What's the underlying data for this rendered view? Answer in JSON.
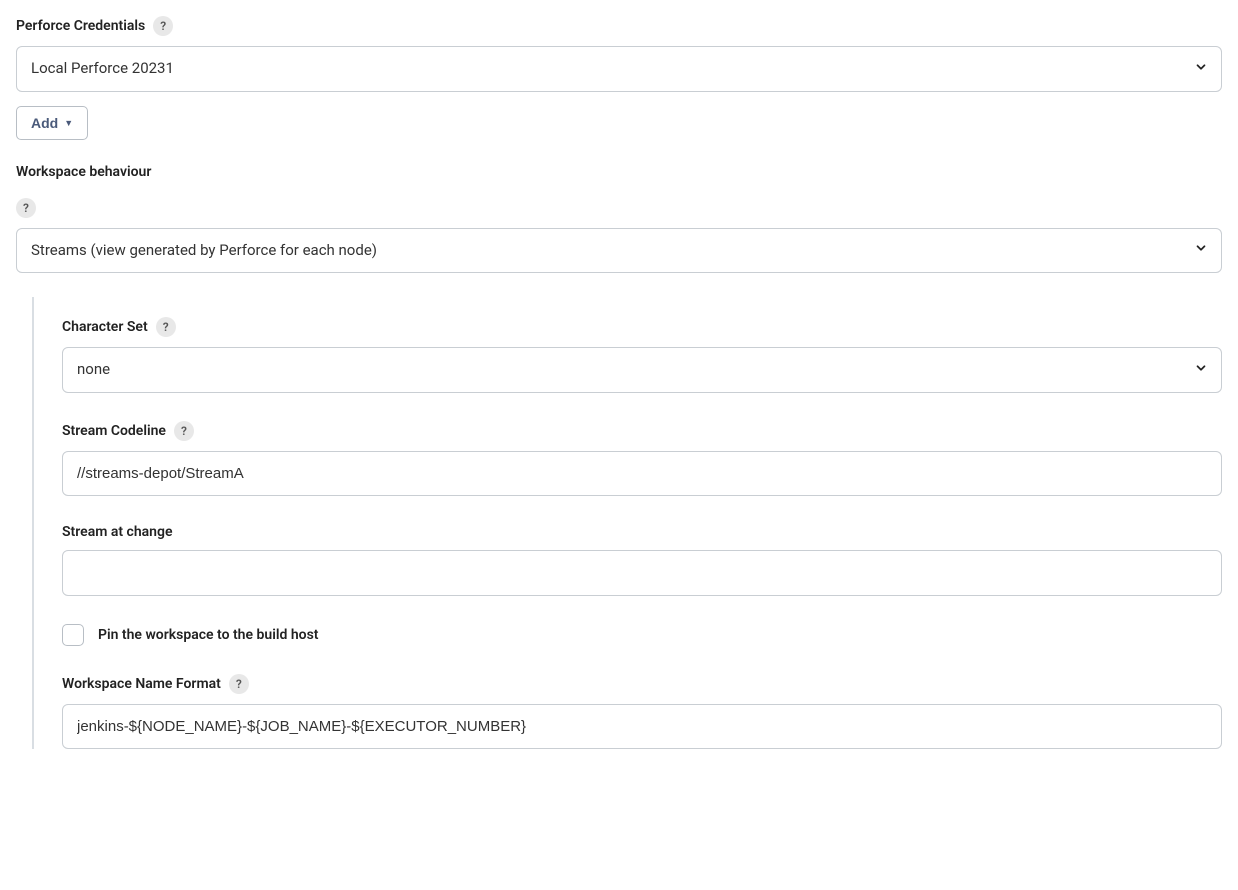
{
  "perforce_credentials": {
    "label": "Perforce Credentials",
    "value": "Local Perforce 20231",
    "add_button_label": "Add"
  },
  "workspace_behaviour": {
    "label": "Workspace behaviour",
    "value": "Streams (view generated by Perforce for each node)"
  },
  "character_set": {
    "label": "Character Set",
    "value": "none"
  },
  "stream_codeline": {
    "label": "Stream Codeline",
    "value": "//streams-depot/StreamA"
  },
  "stream_at_change": {
    "label": "Stream at change",
    "value": ""
  },
  "pin_workspace": {
    "label": "Pin the workspace to the build host",
    "checked": false
  },
  "workspace_name_format": {
    "label": "Workspace Name Format",
    "value": "jenkins-${NODE_NAME}-${JOB_NAME}-${EXECUTOR_NUMBER}"
  },
  "help_glyph": "?"
}
